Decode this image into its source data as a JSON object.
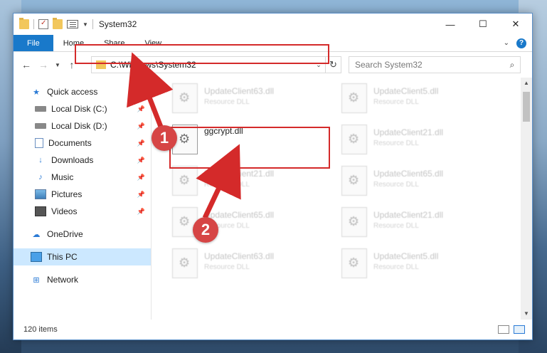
{
  "window": {
    "title": "System32",
    "controls": {
      "minimize": "—",
      "maximize": "☐",
      "close": "✕"
    }
  },
  "ribbon": {
    "tabs": [
      {
        "label": "File"
      },
      {
        "label": "Home"
      },
      {
        "label": "Share"
      },
      {
        "label": "View"
      }
    ],
    "expand_icon": "chevron-down-icon",
    "help_label": "?"
  },
  "nav": {
    "address": "C:\\Windows\\System32",
    "search_placeholder": "Search System32"
  },
  "sidebar": {
    "items": [
      {
        "label": "Quick access",
        "icon": "star-icon",
        "pinned": false
      },
      {
        "label": "Local Disk (C:)",
        "icon": "drive-icon",
        "pinned": true
      },
      {
        "label": "Local Disk (D:)",
        "icon": "drive-icon",
        "pinned": true
      },
      {
        "label": "Documents",
        "icon": "documents-icon",
        "pinned": true
      },
      {
        "label": "Downloads",
        "icon": "download-icon",
        "pinned": true
      },
      {
        "label": "Music",
        "icon": "music-icon",
        "pinned": true
      },
      {
        "label": "Pictures",
        "icon": "pictures-icon",
        "pinned": true
      },
      {
        "label": "Videos",
        "icon": "videos-icon",
        "pinned": true
      },
      {
        "label": "OneDrive",
        "icon": "cloud-icon",
        "pinned": false
      },
      {
        "label": "This PC",
        "icon": "computer-icon",
        "pinned": false,
        "selected": true
      },
      {
        "label": "Network",
        "icon": "network-icon",
        "pinned": false
      }
    ]
  },
  "files": [
    {
      "name": "UpdateClient63.dll",
      "type": "Resource DLL"
    },
    {
      "name": "UpdateClient5.dll",
      "type": "Resource DLL"
    },
    {
      "name": "ggcrypt.dll",
      "type": "",
      "active": true
    },
    {
      "name": "UpdateClient21.dll",
      "type": "Resource DLL"
    },
    {
      "name": "UpdateClient21.dll",
      "type": "Resource DLL"
    },
    {
      "name": "UpdateClient65.dll",
      "type": "Resource DLL"
    },
    {
      "name": "UpdateClient65.dll",
      "type": "Resource DLL"
    },
    {
      "name": "UpdateClient21.dll",
      "type": "Resource DLL"
    },
    {
      "name": "UpdateClient63.dll",
      "type": "Resource DLL"
    },
    {
      "name": "UpdateClient5.dll",
      "type": "Resource DLL"
    }
  ],
  "status": {
    "item_count": "120 items"
  },
  "annotations": {
    "step1": "1",
    "step2": "2",
    "color": "#d42a2a"
  }
}
